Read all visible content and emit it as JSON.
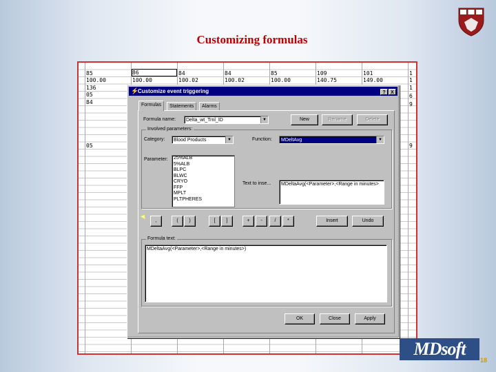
{
  "slide": {
    "title": "Customizing formulas",
    "logo_text": "MDsoft",
    "page_number": "18",
    "colors": {
      "title": "#c00000",
      "frame": "#d03030",
      "logo_bg": "#2e4e86"
    }
  },
  "spreadsheet": {
    "row1": [
      "85",
      "86",
      "84",
      "84",
      "85",
      "109",
      "101"
    ],
    "row2": [
      "100.00",
      "100.00",
      "100.02",
      "100.02",
      "100.00",
      "140.75",
      "149.00"
    ],
    "left_col": [
      "136",
      "05",
      "84",
      "",
      "",
      "",
      "05"
    ],
    "right_col": [
      "1",
      "1",
      "1",
      "6",
      "9",
      "",
      "9"
    ]
  },
  "dialog": {
    "title": "Customize event triggering",
    "title_icon": "lightning-icon",
    "help_glyph": "?",
    "close_glyph": "X",
    "tabs": [
      "Formulas",
      "Statements",
      "Alarms"
    ],
    "formula_name_label": "Formula name:",
    "formula_name_value": "Delta_wt_Trnl_ID",
    "new_label": "New",
    "rename_label": "Rename",
    "delete_label": "Delete",
    "parameters_group": "Involved parameters:",
    "category_label": "Category:",
    "category_value": "Blood Products",
    "function_label": "Function:",
    "function_value": "MDeltAvg",
    "parameter_label": "Parameter:",
    "parameters": [
      "25%ALB",
      "5%ALB",
      "BLPC",
      "BLWC",
      "CRYO",
      "FFP",
      "MPLT",
      "PLTPHERES"
    ],
    "text_to_insert_label": "Text to inse...",
    "text_to_insert_value": "MDeltaAvg(<Parameter>,<Range in minutes>",
    "operators": [
      ",",
      "(",
      ")",
      "[",
      "]",
      "+",
      "-",
      "/",
      "*"
    ],
    "insert_label": "Insert",
    "undo_label": "Undo",
    "formula_text_label": "Formula text:",
    "formula_text_value": "MDeltaAvg(<Parameter>,<Range in minutes>)",
    "ok_label": "OK",
    "close_label": "Close",
    "apply_label": "Apply"
  }
}
